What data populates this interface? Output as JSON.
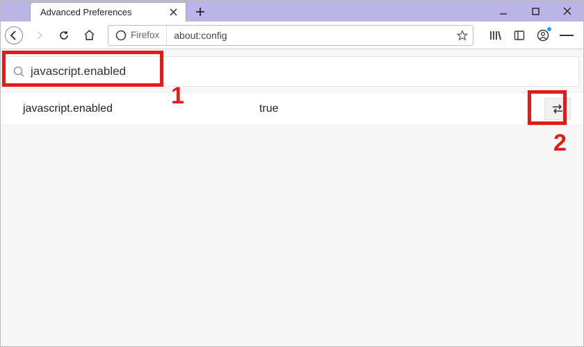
{
  "window": {
    "tab_title": "Advanced Preferences",
    "identity_label": "Firefox",
    "url": "about:config"
  },
  "search": {
    "value": "javascript.enabled"
  },
  "results": [
    {
      "name": "javascript.enabled",
      "value": "true"
    }
  ],
  "annotations": {
    "label1": "1",
    "label2": "2"
  }
}
